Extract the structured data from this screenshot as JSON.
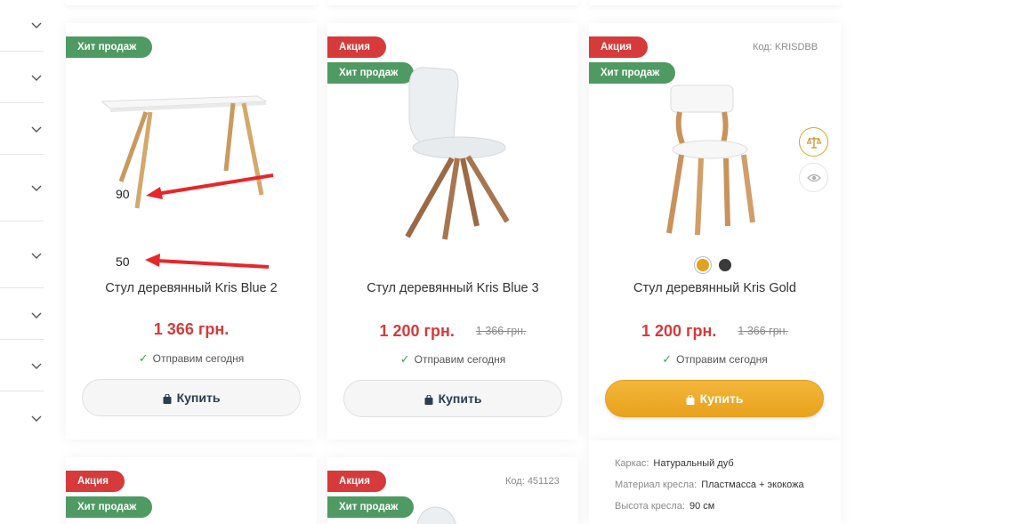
{
  "filters": {
    "rows": 8
  },
  "products": [
    {
      "badges": [
        "Хит продаж"
      ],
      "code": "",
      "title": "Стул деревянный Kris Blue 2",
      "price": "1 366 грн.",
      "old_price": "",
      "shipping": "Отправим сегодня",
      "buy_label": "Купить",
      "annotations": [
        "90",
        "50"
      ]
    },
    {
      "badges": [
        "Акция",
        "Хит продаж"
      ],
      "code": "",
      "title": "Стул деревянный Kris Blue 3",
      "price": "1 200 грн.",
      "old_price": "1 366 грн.",
      "shipping": "Отправим сегодня",
      "buy_label": "Купить"
    },
    {
      "badges": [
        "Акция",
        "Хит продаж"
      ],
      "code": "Код: KRISDBB",
      "title": "Стул деревянный Kris Gold",
      "price": "1 200 грн.",
      "old_price": "1 366 грн.",
      "shipping": "Отправим сегодня",
      "buy_label": "Купить",
      "colors": [
        "#e4a11f",
        "#3a3a3a"
      ],
      "specs": [
        {
          "key": "Каркас:",
          "value": "Натуральный дуб"
        },
        {
          "key": "Материал кресла:",
          "value": "Пластмасса + экокожа"
        },
        {
          "key": "Высота кресла:",
          "value": "90 см"
        }
      ]
    },
    {
      "badges": [
        "Акция",
        "Хит продаж"
      ],
      "code": ""
    },
    {
      "badges": [
        "Акция",
        "Хит продаж"
      ],
      "code": "Код: 451123"
    }
  ],
  "colors": {
    "sale": "#d63a3a",
    "hit": "#4f9a63",
    "price": "#d63a3a",
    "accent": "#e8a21c",
    "check": "#3da14a"
  }
}
